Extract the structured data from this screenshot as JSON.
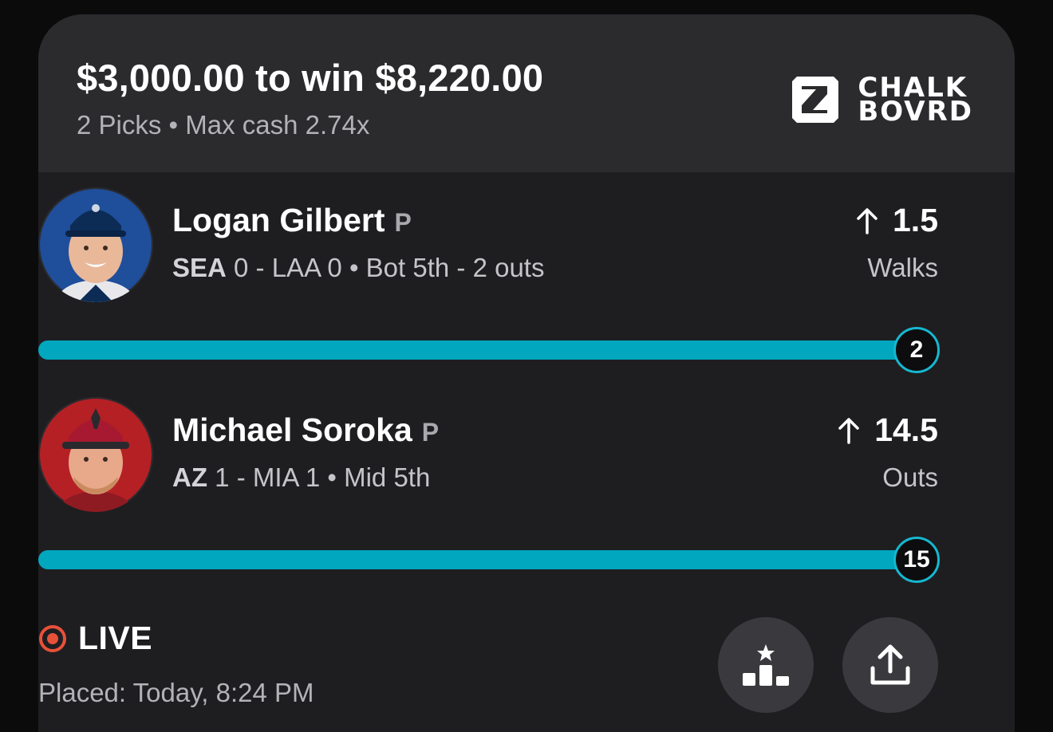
{
  "header": {
    "title": "$3,000.00 to win $8,220.00",
    "subtitle": "2 Picks • Max cash 2.74x",
    "brand_line1": "CHALK",
    "brand_line2": "BOVRD"
  },
  "picks": [
    {
      "name": "Logan Gilbert",
      "position": "P",
      "team": "SEA",
      "game_rest": " 0 - LAA 0 • Bot 5th  -  2 outs",
      "direction": "up-arrow-icon",
      "line": "1.5",
      "stat": "Walks",
      "current": "2",
      "progress": 1.0,
      "avatar_bg": "#1f4e9a",
      "cap_color": "#0c2c56"
    },
    {
      "name": "Michael Soroka",
      "position": "P",
      "team": "AZ",
      "game_rest": " 1 - MIA 1 • Mid 5th",
      "direction": "up-arrow-icon",
      "line": "14.5",
      "stat": "Outs",
      "current": "15",
      "progress": 1.0,
      "avatar_bg": "#b52025",
      "cap_color": "#a71930"
    }
  ],
  "status": {
    "live_label": "LIVE",
    "placed": "Placed: Today, 8:24 PM"
  },
  "colors": {
    "accent": "#00a7bf",
    "live": "#e8503a",
    "card": "#1e1e21",
    "header": "#2b2b2e"
  }
}
